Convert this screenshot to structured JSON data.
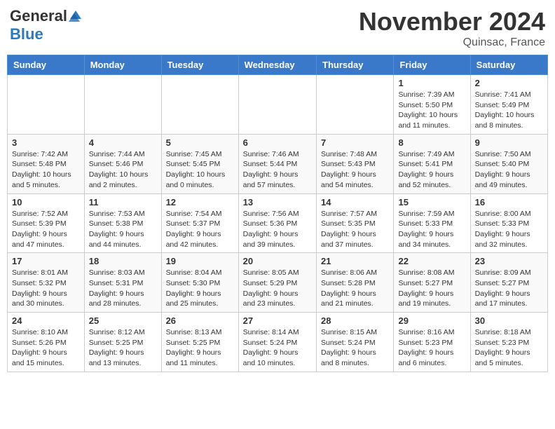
{
  "header": {
    "logo_general": "General",
    "logo_blue": "Blue",
    "month_title": "November 2024",
    "location": "Quinsac, France"
  },
  "days_of_week": [
    "Sunday",
    "Monday",
    "Tuesday",
    "Wednesday",
    "Thursday",
    "Friday",
    "Saturday"
  ],
  "weeks": [
    [
      {
        "day": "",
        "info": ""
      },
      {
        "day": "",
        "info": ""
      },
      {
        "day": "",
        "info": ""
      },
      {
        "day": "",
        "info": ""
      },
      {
        "day": "",
        "info": ""
      },
      {
        "day": "1",
        "info": "Sunrise: 7:39 AM\nSunset: 5:50 PM\nDaylight: 10 hours and 11 minutes."
      },
      {
        "day": "2",
        "info": "Sunrise: 7:41 AM\nSunset: 5:49 PM\nDaylight: 10 hours and 8 minutes."
      }
    ],
    [
      {
        "day": "3",
        "info": "Sunrise: 7:42 AM\nSunset: 5:48 PM\nDaylight: 10 hours and 5 minutes."
      },
      {
        "day": "4",
        "info": "Sunrise: 7:44 AM\nSunset: 5:46 PM\nDaylight: 10 hours and 2 minutes."
      },
      {
        "day": "5",
        "info": "Sunrise: 7:45 AM\nSunset: 5:45 PM\nDaylight: 10 hours and 0 minutes."
      },
      {
        "day": "6",
        "info": "Sunrise: 7:46 AM\nSunset: 5:44 PM\nDaylight: 9 hours and 57 minutes."
      },
      {
        "day": "7",
        "info": "Sunrise: 7:48 AM\nSunset: 5:43 PM\nDaylight: 9 hours and 54 minutes."
      },
      {
        "day": "8",
        "info": "Sunrise: 7:49 AM\nSunset: 5:41 PM\nDaylight: 9 hours and 52 minutes."
      },
      {
        "day": "9",
        "info": "Sunrise: 7:50 AM\nSunset: 5:40 PM\nDaylight: 9 hours and 49 minutes."
      }
    ],
    [
      {
        "day": "10",
        "info": "Sunrise: 7:52 AM\nSunset: 5:39 PM\nDaylight: 9 hours and 47 minutes."
      },
      {
        "day": "11",
        "info": "Sunrise: 7:53 AM\nSunset: 5:38 PM\nDaylight: 9 hours and 44 minutes."
      },
      {
        "day": "12",
        "info": "Sunrise: 7:54 AM\nSunset: 5:37 PM\nDaylight: 9 hours and 42 minutes."
      },
      {
        "day": "13",
        "info": "Sunrise: 7:56 AM\nSunset: 5:36 PM\nDaylight: 9 hours and 39 minutes."
      },
      {
        "day": "14",
        "info": "Sunrise: 7:57 AM\nSunset: 5:35 PM\nDaylight: 9 hours and 37 minutes."
      },
      {
        "day": "15",
        "info": "Sunrise: 7:59 AM\nSunset: 5:33 PM\nDaylight: 9 hours and 34 minutes."
      },
      {
        "day": "16",
        "info": "Sunrise: 8:00 AM\nSunset: 5:33 PM\nDaylight: 9 hours and 32 minutes."
      }
    ],
    [
      {
        "day": "17",
        "info": "Sunrise: 8:01 AM\nSunset: 5:32 PM\nDaylight: 9 hours and 30 minutes."
      },
      {
        "day": "18",
        "info": "Sunrise: 8:03 AM\nSunset: 5:31 PM\nDaylight: 9 hours and 28 minutes."
      },
      {
        "day": "19",
        "info": "Sunrise: 8:04 AM\nSunset: 5:30 PM\nDaylight: 9 hours and 25 minutes."
      },
      {
        "day": "20",
        "info": "Sunrise: 8:05 AM\nSunset: 5:29 PM\nDaylight: 9 hours and 23 minutes."
      },
      {
        "day": "21",
        "info": "Sunrise: 8:06 AM\nSunset: 5:28 PM\nDaylight: 9 hours and 21 minutes."
      },
      {
        "day": "22",
        "info": "Sunrise: 8:08 AM\nSunset: 5:27 PM\nDaylight: 9 hours and 19 minutes."
      },
      {
        "day": "23",
        "info": "Sunrise: 8:09 AM\nSunset: 5:27 PM\nDaylight: 9 hours and 17 minutes."
      }
    ],
    [
      {
        "day": "24",
        "info": "Sunrise: 8:10 AM\nSunset: 5:26 PM\nDaylight: 9 hours and 15 minutes."
      },
      {
        "day": "25",
        "info": "Sunrise: 8:12 AM\nSunset: 5:25 PM\nDaylight: 9 hours and 13 minutes."
      },
      {
        "day": "26",
        "info": "Sunrise: 8:13 AM\nSunset: 5:25 PM\nDaylight: 9 hours and 11 minutes."
      },
      {
        "day": "27",
        "info": "Sunrise: 8:14 AM\nSunset: 5:24 PM\nDaylight: 9 hours and 10 minutes."
      },
      {
        "day": "28",
        "info": "Sunrise: 8:15 AM\nSunset: 5:24 PM\nDaylight: 9 hours and 8 minutes."
      },
      {
        "day": "29",
        "info": "Sunrise: 8:16 AM\nSunset: 5:23 PM\nDaylight: 9 hours and 6 minutes."
      },
      {
        "day": "30",
        "info": "Sunrise: 8:18 AM\nSunset: 5:23 PM\nDaylight: 9 hours and 5 minutes."
      }
    ]
  ]
}
